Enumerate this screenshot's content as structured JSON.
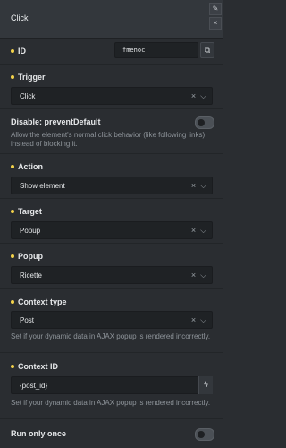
{
  "header": {
    "title": "Click"
  },
  "id_row": {
    "label": "ID",
    "value": "fmenoc"
  },
  "trigger": {
    "label": "Trigger",
    "value": "Click"
  },
  "prevent_default": {
    "label": "Disable: preventDefault",
    "help": "Allow the element's normal click behavior (like following links) instead of blocking it.",
    "enabled": false
  },
  "action": {
    "label": "Action",
    "value": "Show element"
  },
  "target": {
    "label": "Target",
    "value": "Popup"
  },
  "popup": {
    "label": "Popup",
    "value": "Ricette"
  },
  "context_type": {
    "label": "Context type",
    "value": "Post",
    "help": "Set if your dynamic data in AJAX popup is rendered incorrectly."
  },
  "context_id": {
    "label": "Context ID",
    "value": "{post_id}",
    "help": "Set if your dynamic data in AJAX popup is rendered incorrectly."
  },
  "run_once": {
    "label": "Run only once",
    "enabled": false
  },
  "icons": {
    "clear": "×",
    "chevron": "⌵",
    "bolt": "ϟ",
    "edit": "✎",
    "close": "×",
    "copy": "⧉"
  }
}
